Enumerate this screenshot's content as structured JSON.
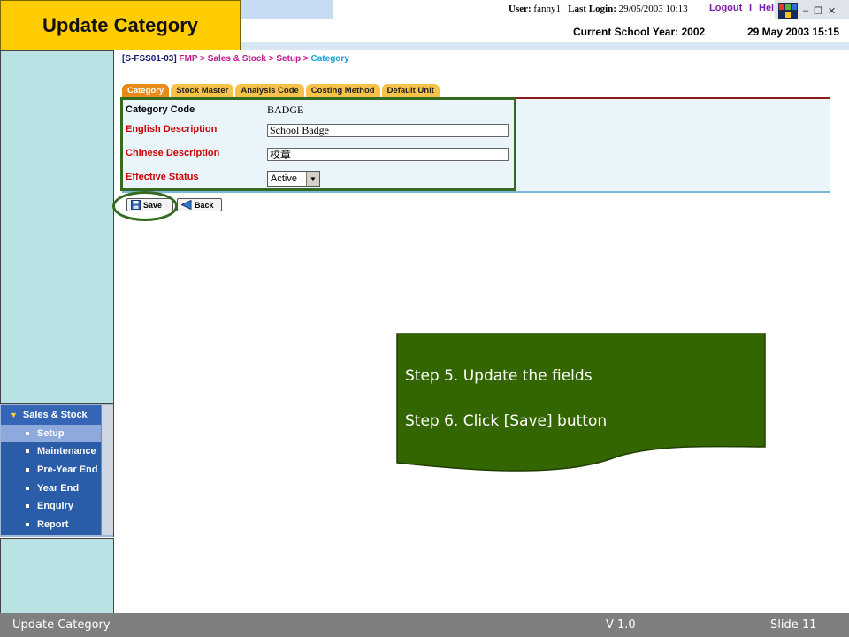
{
  "slide": {
    "title": "Update Category",
    "footer_left": "Update Category",
    "footer_version": "V 1.0",
    "footer_slide": "Slide 11"
  },
  "header": {
    "user_label": "User:",
    "user_value": "fanny1",
    "last_login_label": "Last Login:",
    "last_login_value": "29/05/2003 10:13",
    "logout": "Logout",
    "separator": "I",
    "help": "Help",
    "current_year": "Current School Year: 2002",
    "date_time": "29 May 2003 15:15"
  },
  "breadcrumb": {
    "code": "[S-FSS01-03]",
    "path": "FMP > Sales & Stock > Setup > ",
    "current": "Category"
  },
  "tabs": [
    "Category",
    "Stock Master",
    "Analysis Code",
    "Costing Method",
    "Default Unit"
  ],
  "active_tab": "Category",
  "form": {
    "category_code_label": "Category Code",
    "category_code_value": "BADGE",
    "english_desc_label": "English Description",
    "english_desc_value": "School Badge",
    "chinese_desc_label": "Chinese Description",
    "chinese_desc_value": "校章",
    "status_label": "Effective Status",
    "status_value": "Active"
  },
  "buttons": {
    "save": "Save",
    "back": "Back"
  },
  "menu": {
    "heading": "Sales & Stock",
    "items": [
      "Setup",
      "Maintenance",
      "Pre-Year End",
      "Year End",
      "Enquiry",
      "Report"
    ],
    "active": "Setup"
  },
  "callout": {
    "step5": "Step 5. Update the fields",
    "step6": "Step 6. Click [Save] button",
    "color": "#336600"
  },
  "colors": {
    "title_bg": "#ffcc00",
    "highlight": "#356a20",
    "required_label": "#cc0000",
    "tab": "#f7c24a",
    "tab_active": "#e88a1a"
  }
}
